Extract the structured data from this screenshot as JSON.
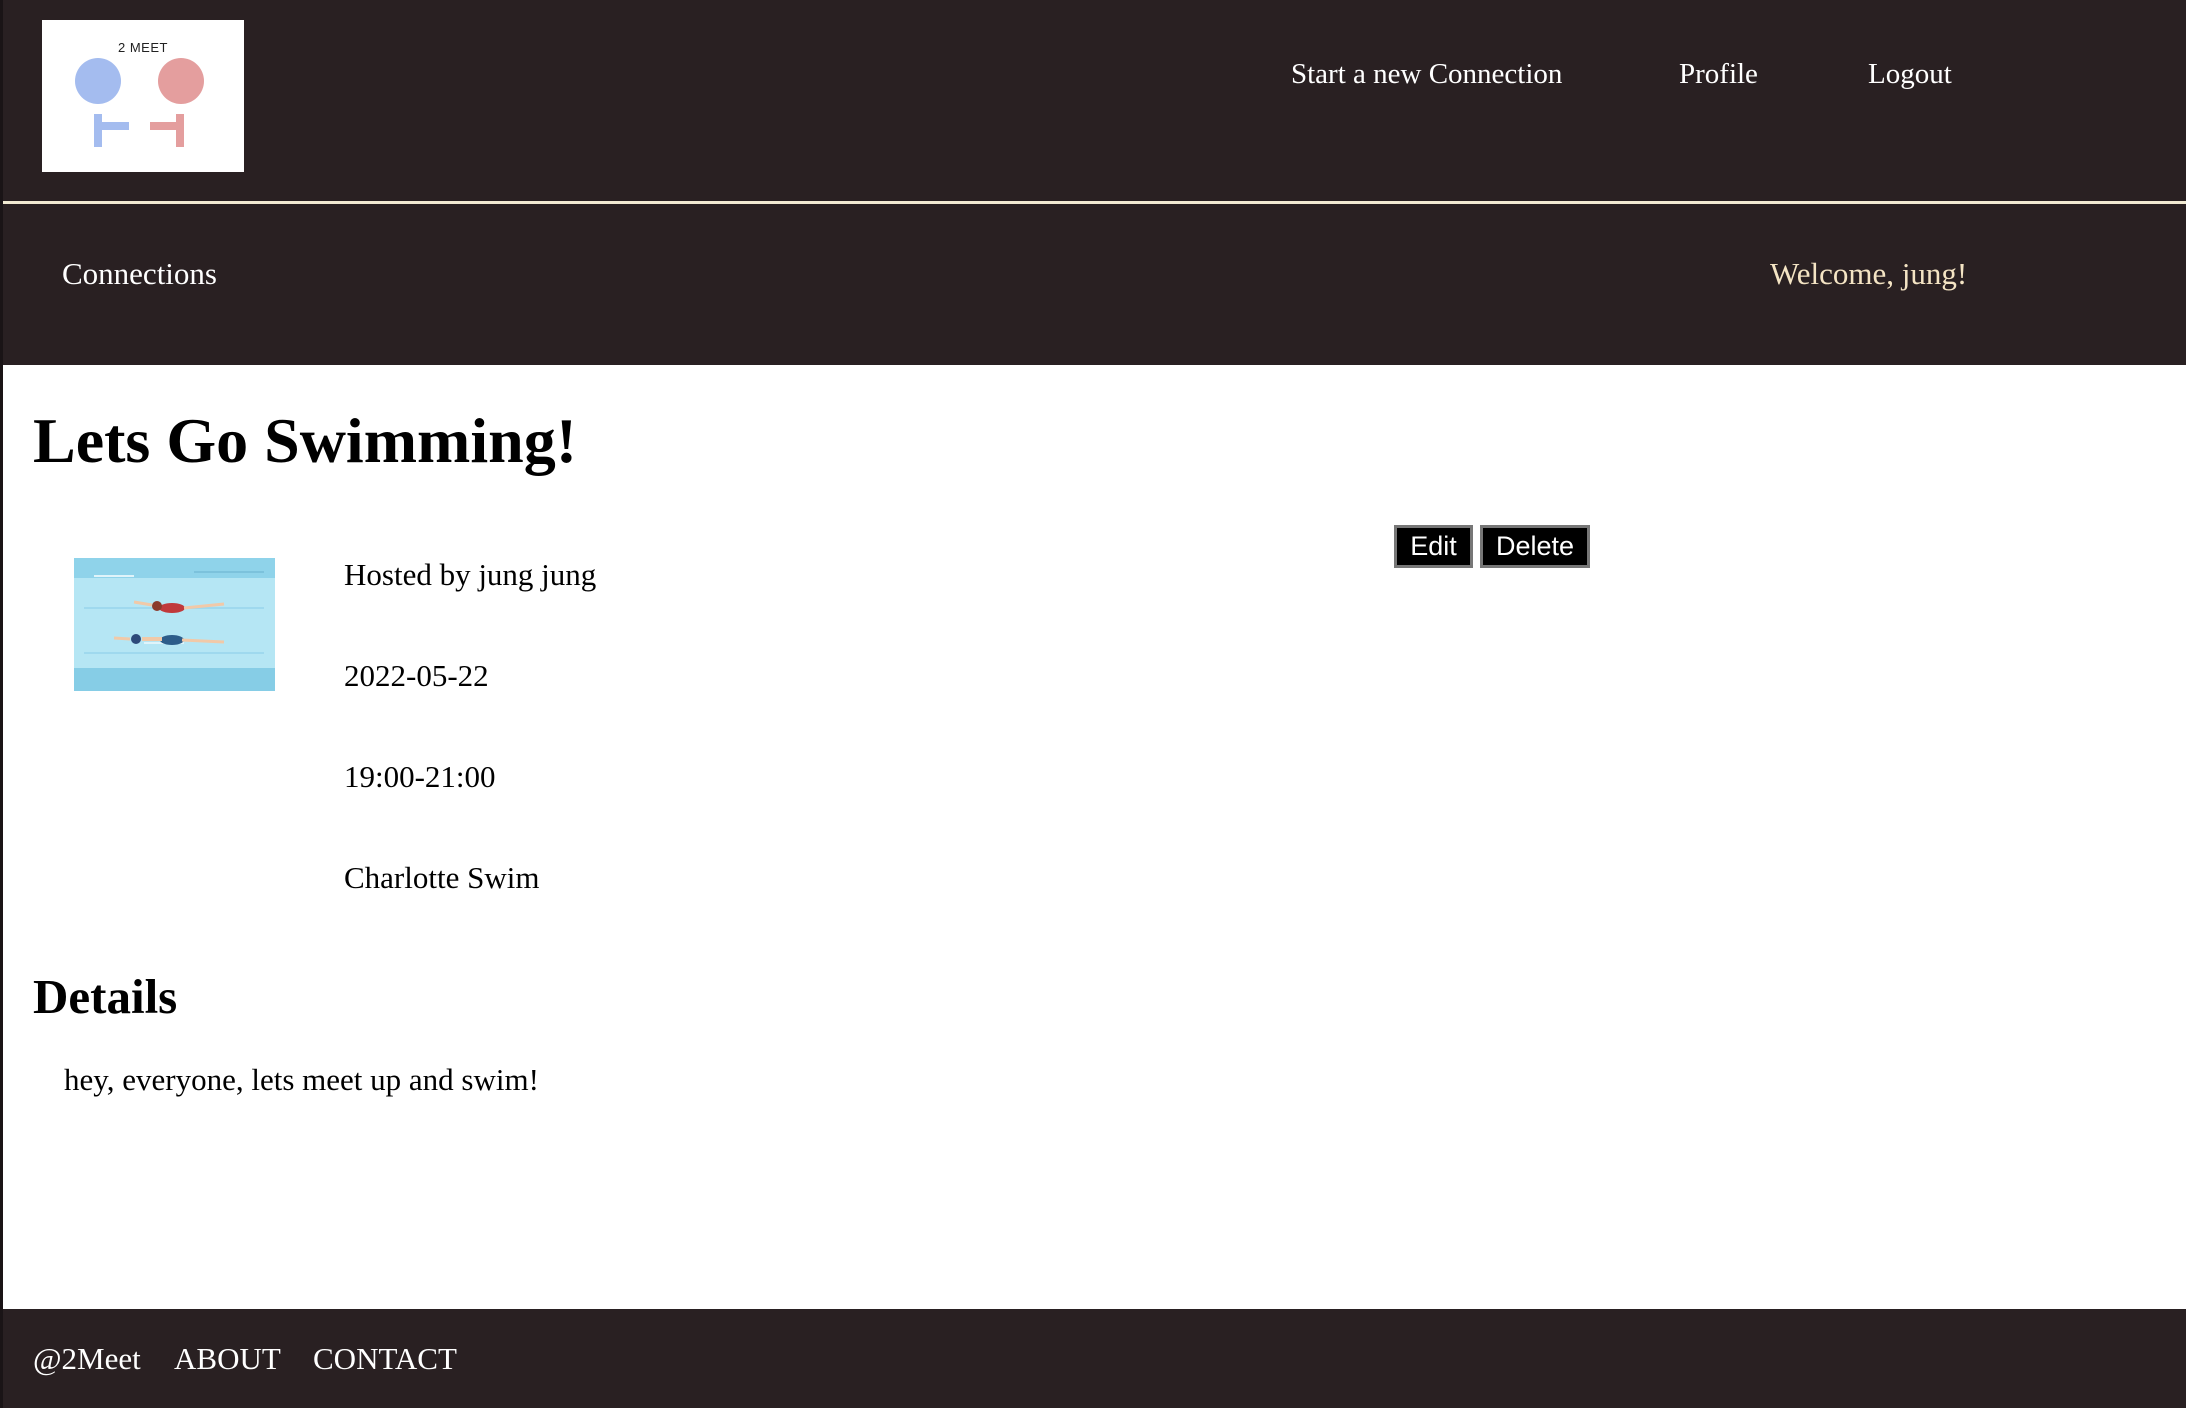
{
  "logo": {
    "text": "2 MEET"
  },
  "nav": {
    "new_connection": "Start a new Connection",
    "profile": "Profile",
    "logout": "Logout"
  },
  "subnav": {
    "connections": "Connections",
    "welcome": "Welcome, jung!"
  },
  "connection": {
    "title": "Lets Go Swimming!",
    "host": "Hosted by jung jung",
    "date": "2022-05-22",
    "time": "19:00-21:00",
    "location": "Charlotte Swim",
    "image_icon": "swimming-image"
  },
  "actions": {
    "edit": "Edit",
    "delete": "Delete"
  },
  "details": {
    "heading": "Details",
    "text": "hey, everyone, lets meet up and swim!"
  },
  "footer": {
    "brand": "@2Meet",
    "about": "ABOUT",
    "contact": "CONTACT"
  },
  "colors": {
    "header_bg": "#292022",
    "welcome_text": "#f4e4c4",
    "divider": "#f2ead2"
  }
}
